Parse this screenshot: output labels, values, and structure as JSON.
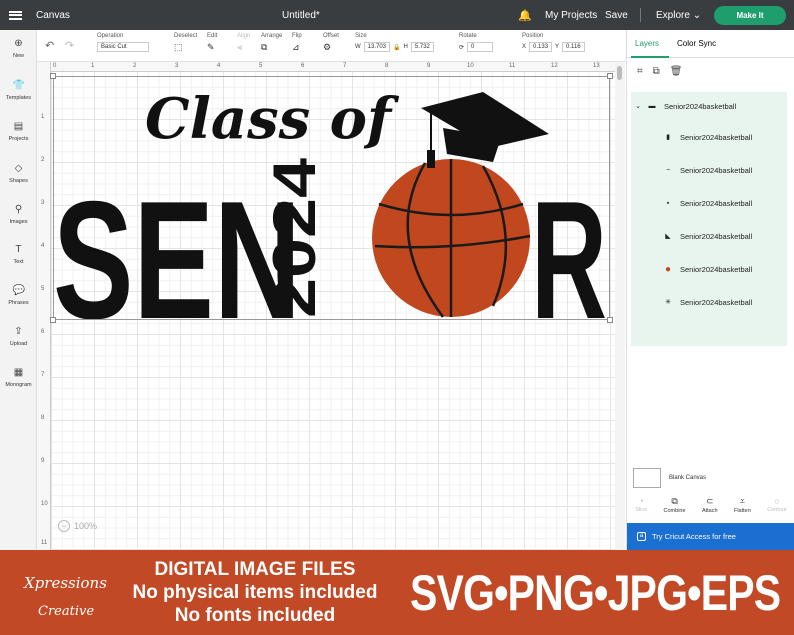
{
  "topbar": {
    "app_name": "Canvas",
    "doc_title": "Untitled*",
    "my_projects": "My Projects",
    "save": "Save",
    "explore": "Explore",
    "make_it": "Make It"
  },
  "toolbar": {
    "operation_label": "Operation",
    "operation_value": "Basic Cut",
    "deselect_label": "Deselect",
    "edit_label": "Edit",
    "align_label": "Align",
    "arrange_label": "Arrange",
    "flip_label": "Flip",
    "offset_label": "Offset",
    "size_label": "Size",
    "w_label": "W",
    "w_value": "13.703",
    "h_label": "H",
    "h_value": "5.732",
    "rotate_label": "Rotate",
    "rotate_value": "0",
    "position_label": "Position",
    "x_label": "X",
    "x_value": "0.133",
    "y_label": "Y",
    "y_value": "0.116"
  },
  "sidebar": {
    "items": [
      {
        "label": "New",
        "icon": "plus-icon"
      },
      {
        "label": "Templates",
        "icon": "shirt-icon"
      },
      {
        "label": "Projects",
        "icon": "projects-icon"
      },
      {
        "label": "Shapes",
        "icon": "shapes-icon"
      },
      {
        "label": "Images",
        "icon": "images-icon"
      },
      {
        "label": "Text",
        "icon": "text-icon"
      },
      {
        "label": "Phrases",
        "icon": "phrases-icon"
      },
      {
        "label": "Upload",
        "icon": "upload-icon"
      },
      {
        "label": "Monogram",
        "icon": "monogram-icon"
      }
    ]
  },
  "ruler": {
    "top": [
      "0",
      "1",
      "2",
      "3",
      "4",
      "5",
      "6",
      "7",
      "8",
      "9",
      "10",
      "11",
      "12",
      "13"
    ],
    "left": [
      "1",
      "2",
      "3",
      "4",
      "5",
      "6",
      "7",
      "8",
      "9",
      "10",
      "11"
    ]
  },
  "canvas": {
    "zoom": "100%",
    "design": {
      "script_line": "Class of",
      "senior_left": "SEN",
      "senior_right": "R",
      "year": "2024"
    }
  },
  "panel": {
    "tab_layers": "Layers",
    "tab_color_sync": "Color Sync",
    "group_name": "Senior2024basketball",
    "layers": [
      {
        "name": "Senior2024basketball",
        "thumb": "year-text-thumb"
      },
      {
        "name": "Senior2024basketball",
        "thumb": "class-of-thumb"
      },
      {
        "name": "Senior2024basketball",
        "thumb": "senior-letters-thumb"
      },
      {
        "name": "Senior2024basketball",
        "thumb": "grad-cap-thumb"
      },
      {
        "name": "Senior2024basketball",
        "thumb": "basketball-thumb"
      },
      {
        "name": "Senior2024basketball",
        "thumb": "ball-lines-thumb"
      }
    ],
    "blank_canvas": "Blank Canvas",
    "bottom_tools": [
      "Slice",
      "Combine",
      "Attach",
      "Flatten",
      "Contour"
    ],
    "access": "Try Cricut Access for free"
  },
  "banner": {
    "brand_line1": "Xpressions",
    "brand_line2": "Creative",
    "line1": "DIGITAL IMAGE FILES",
    "line2": "No physical items included",
    "line3": "No fonts included",
    "formats": "SVG•PNG•JPG•EPS"
  },
  "colors": {
    "topbar": "#3a3d40",
    "accent": "#1f9e6d",
    "banner": "#c24925",
    "ball": "#c1471f",
    "access": "#1a6fd1"
  }
}
